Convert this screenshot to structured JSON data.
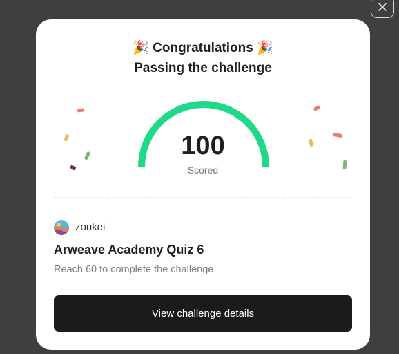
{
  "dialog": {
    "title": "🎉 Congratulations 🎉",
    "subtitle": "Passing the challenge",
    "score": "100",
    "score_label": "Scored",
    "user": {
      "name": "zoukei"
    },
    "quiz_title": "Arweave Academy Quiz 6",
    "requirement": "Reach 60 to complete the challenge",
    "button_label": "View challenge details",
    "progress": 1.0
  },
  "colors": {
    "gauge": "#1fd98a",
    "button_bg": "#1b1b1b",
    "overlay": "#3f3f3f"
  },
  "icons": {
    "close": "close-icon",
    "avatar": "avatar",
    "confetti": "confetti"
  }
}
